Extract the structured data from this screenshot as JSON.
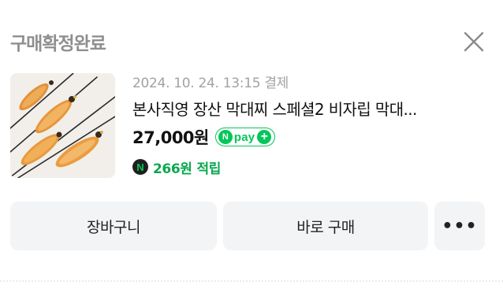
{
  "header": {
    "title": "구매확정완료",
    "close_icon": "close-icon"
  },
  "product": {
    "thumbnail_icon": "fishing-float-product-image",
    "paid_at": "2024. 10. 24. 13:15 결제",
    "name": "본사직영 장산 막대찌 스페셜2 비자립 막대...",
    "price": "27,000원",
    "npay": {
      "n_letter": "N",
      "label": "pay",
      "plus": "+"
    },
    "points": {
      "icon_letter": "N",
      "amount": "266원",
      "label": "적립"
    }
  },
  "actions": {
    "cart_label": "장바구니",
    "buy_label": "바로 구매",
    "more_label": "•••"
  },
  "colors": {
    "accent_green": "#03c75a",
    "points_green": "#0aa84f",
    "title_gray": "#8f8f8f",
    "button_bg": "#f3f4f6"
  }
}
